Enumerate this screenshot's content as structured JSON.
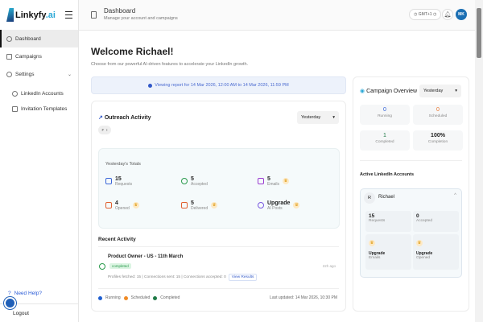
{
  "app": {
    "brand": "Linkyfy",
    "brand_suffix": ".ai"
  },
  "sidebar": {
    "items": [
      {
        "label": "Dashboard"
      },
      {
        "label": "Campaigns"
      },
      {
        "label": "Settings"
      },
      {
        "label": "LinkedIn Accounts"
      },
      {
        "label": "Invitation Templates"
      }
    ],
    "help": "Need Help?",
    "logout": "Logout"
  },
  "header": {
    "title": "Dashboard",
    "subtitle": "Manage your account and campaigns",
    "timezone": "GMT+1",
    "avatar_initials": "MK"
  },
  "main": {
    "welcome": "Welcome Richael!",
    "intro": "Choose from our powerful AI-driven features to accelerate your LinkedIn growth.",
    "banner": "Viewing report for 14 Mar 2026, 12:00 AM to 14 Mar 2026, 11:59 PM",
    "outreach": {
      "title": "Outreach Activity",
      "period": "Yesterday",
      "filter": [
        "F",
        "I"
      ],
      "totals_title": "Yesterday's Totals",
      "stats": [
        {
          "value": "15",
          "label": "Requests"
        },
        {
          "value": "5",
          "label": "Accepted"
        },
        {
          "value": "5",
          "label": "Emails"
        },
        {
          "value": "4",
          "label": "Opened"
        },
        {
          "value": "5",
          "label": "Delivered"
        },
        {
          "value": "Upgrade",
          "label": "AI Posts"
        }
      ]
    },
    "recent": {
      "title": "Recent Activity",
      "items": [
        {
          "title": "Product Owner - US - 11th March",
          "status": "completed",
          "meta": "Profiles fetched: 15 | Connections sent: 15 | Connections accepted: 0",
          "action": "View Results",
          "ago": "22h ago"
        }
      ]
    },
    "legend": [
      {
        "label": "Running",
        "color": "#1f5fd0"
      },
      {
        "label": "Scheduled",
        "color": "#f08a24"
      },
      {
        "label": "Completed",
        "color": "#1e7a46"
      }
    ],
    "last_updated": "Last updated: 14 Mar 2026, 10:30 PM"
  },
  "overview": {
    "title": "Campaign Overview",
    "period": "Yesterday",
    "stats": [
      {
        "value": "0",
        "label": "Running",
        "color": "#2a5bd7"
      },
      {
        "value": "0",
        "label": "Scheduled",
        "color": "#e8742a"
      },
      {
        "value": "1",
        "label": "Completed",
        "color": "#1e7a46"
      },
      {
        "value": "100%",
        "label": "Completion",
        "color": "#111"
      }
    ],
    "accounts_title": "Active LinkedIn Accounts",
    "account": {
      "initial": "R",
      "name": "Richael",
      "stats": [
        {
          "value": "15",
          "label": "Requests"
        },
        {
          "value": "0",
          "label": "Accepted"
        },
        {
          "value": "Upgrade",
          "label": "Emails"
        },
        {
          "value": "Upgrade",
          "label": "Opened"
        }
      ]
    }
  }
}
